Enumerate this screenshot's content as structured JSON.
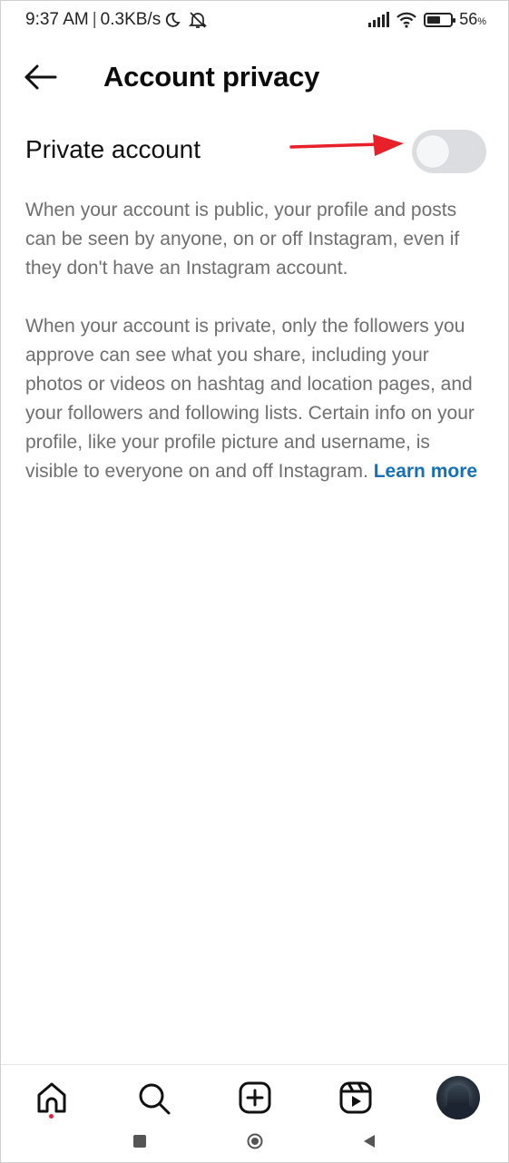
{
  "status_bar": {
    "time": "9:37 AM",
    "separator": "|",
    "speed": "0.3KB/s",
    "battery_level": "56",
    "battery_unit": "%",
    "icons": [
      "moon-icon",
      "muted-bell-icon",
      "signal-icon",
      "wifi-icon",
      "battery-icon"
    ]
  },
  "header": {
    "title": "Account privacy",
    "back_icon": "arrow-left-icon"
  },
  "setting": {
    "label": "Private account",
    "toggle_on": false,
    "annotation": "red-arrow-icon"
  },
  "description": {
    "paragraph1": "When your account is public, your profile and posts can be seen by anyone, on or off Instagram, even if they don't have an Instagram account.",
    "paragraph2": "When your account is private, only the followers you approve can see what you share, including your photos or videos on hashtag and location pages, and your followers and following lists. Certain info on your profile, like your profile picture and username, is visible to everyone on and off Instagram.",
    "learn_more": "Learn more"
  },
  "bottom_nav": {
    "items": [
      "home-icon",
      "search-icon",
      "create-icon",
      "reels-icon",
      "profile-avatar"
    ]
  },
  "system_nav": {
    "items": [
      "recents-icon",
      "home-circle-icon",
      "back-triangle-icon"
    ]
  },
  "colors": {
    "accent_link": "#1471b8",
    "toggle_off": "#dbdde0",
    "annotation_arrow": "#e8202a",
    "notification_dot": "#e4203a"
  }
}
